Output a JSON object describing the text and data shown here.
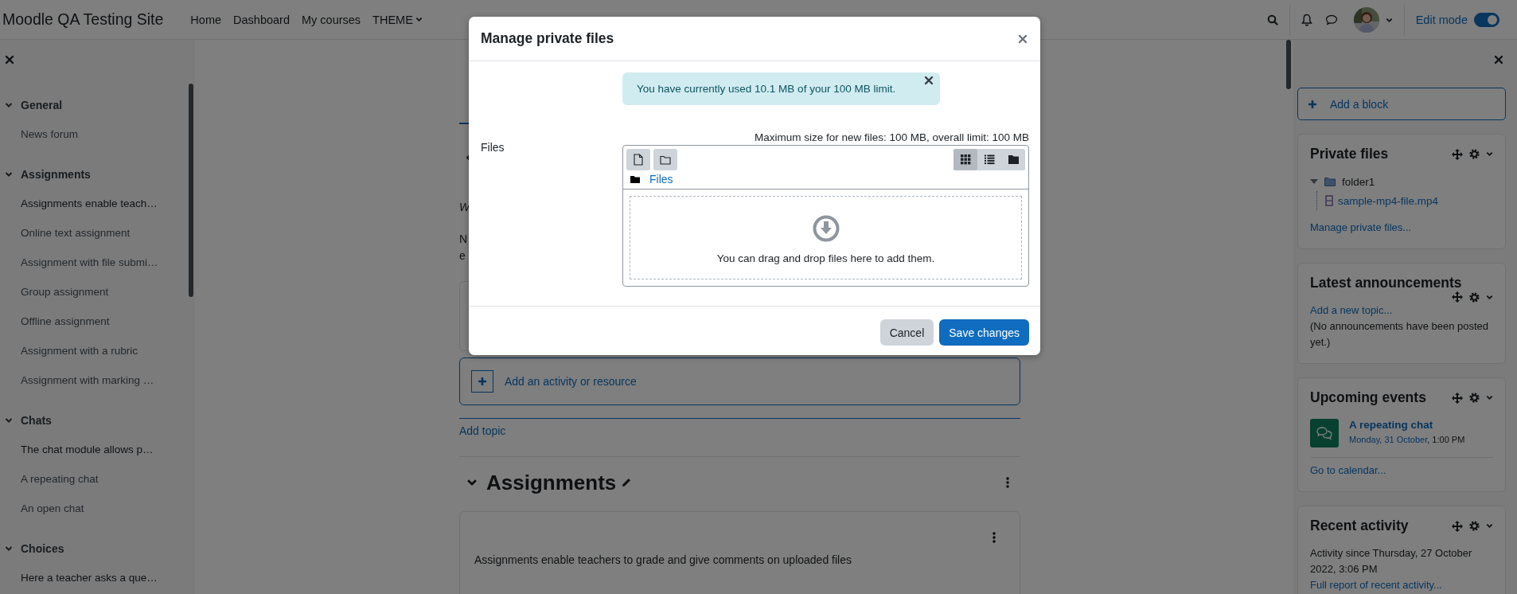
{
  "header": {
    "site_name": "Moodle QA Testing Site",
    "nav": [
      {
        "label": "Home",
        "dropdown": false
      },
      {
        "label": "Dashboard",
        "dropdown": false
      },
      {
        "label": "My courses",
        "dropdown": false
      },
      {
        "label": "THEME",
        "dropdown": true
      }
    ],
    "edit_mode": {
      "label": "Edit mode",
      "on": true
    }
  },
  "course_index": {
    "sections": [
      {
        "title": "General",
        "expanded": true,
        "items": [
          {
            "label": "News forum",
            "kind": "activity"
          }
        ]
      },
      {
        "title": "Assignments",
        "expanded": true,
        "items": [
          {
            "label": "Assignments enable teach…",
            "kind": "label"
          },
          {
            "label": "Online text assignment",
            "kind": "activity"
          },
          {
            "label": "Assignment with file submi…",
            "kind": "activity"
          },
          {
            "label": "Group assignment",
            "kind": "activity"
          },
          {
            "label": "Offline assignment",
            "kind": "activity"
          },
          {
            "label": "Assignment with a rubric",
            "kind": "activity"
          },
          {
            "label": "Assignment with marking …",
            "kind": "activity"
          }
        ]
      },
      {
        "title": "Chats",
        "expanded": true,
        "items": [
          {
            "label": "The chat module allows p…",
            "kind": "label"
          },
          {
            "label": "A repeating chat",
            "kind": "activity"
          },
          {
            "label": "An open chat",
            "kind": "activity"
          }
        ]
      },
      {
        "title": "Choices",
        "expanded": true,
        "items": [
          {
            "label": "Here a teacher asks a que…",
            "kind": "label"
          }
        ]
      }
    ]
  },
  "main": {
    "intro_fragment": "W",
    "text_fragments": [
      "N",
      "e"
    ],
    "add_activity": "Add an activity or resource",
    "add_topic": "Add topic",
    "section_title": "Assignments",
    "section_text": "Assignments enable teachers to grade and give comments on uploaded files"
  },
  "blocks_drawer": {
    "add_block": "Add a block",
    "blocks": [
      {
        "kind": "private_files",
        "title": "Private files",
        "tree": [
          {
            "label": "folder1",
            "expanded": true,
            "children": [
              {
                "label": "sample-mp4-file.mp4"
              }
            ]
          }
        ],
        "link": "Manage private files..."
      },
      {
        "kind": "announcements",
        "title": "Latest announcements",
        "link": "Add a new topic...",
        "text": "(No announcements have been posted yet.)"
      },
      {
        "kind": "events",
        "title": "Upcoming events",
        "events": [
          {
            "title": "A repeating chat",
            "date": "Monday, 31 October",
            "time": ", 1:00 PM"
          }
        ],
        "link": "Go to calendar..."
      },
      {
        "kind": "recent",
        "title": "Recent activity",
        "text": "Activity since Thursday, 27 October 2022, 3:06 PM",
        "link": "Full report of recent activity..."
      }
    ]
  },
  "modal": {
    "title": "Manage private files",
    "alert": "You have currently used 10.1 MB of your 100 MB limit.",
    "field_label": "Files",
    "max_size": "Maximum size for new files: 100 MB, overall limit: 100 MB",
    "path": "Files",
    "view_modes": [
      {
        "kind": "icons",
        "selected": true
      },
      {
        "kind": "list",
        "selected": false
      },
      {
        "kind": "tree",
        "selected": false
      }
    ],
    "drop_hint": "You can drag and drop files here to add them.",
    "buttons": [
      {
        "label": "Cancel",
        "kind": "secondary"
      },
      {
        "label": "Save changes",
        "kind": "primary"
      }
    ]
  }
}
